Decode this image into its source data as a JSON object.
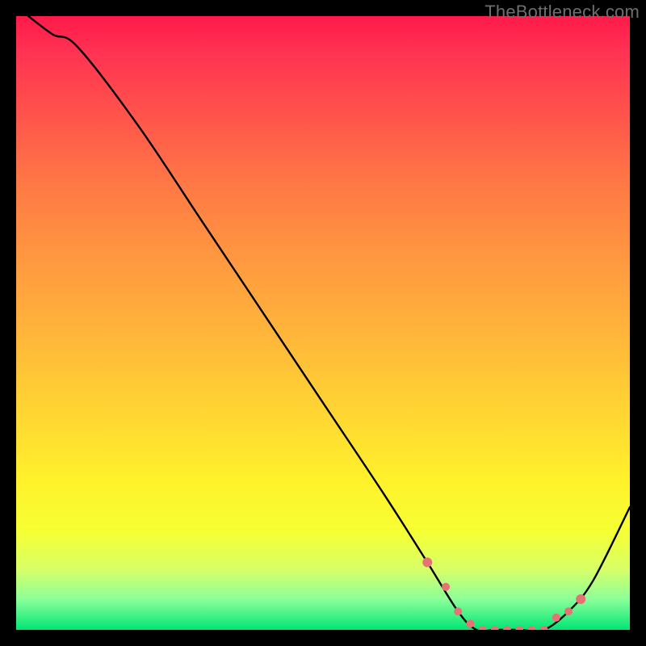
{
  "watermark": "TheBottleneck.com",
  "chart_data": {
    "type": "line",
    "title": "",
    "xlabel": "",
    "ylabel": "",
    "xlim": [
      0,
      100
    ],
    "ylim": [
      0,
      100
    ],
    "series": [
      {
        "name": "bottleneck-curve",
        "x": [
          2,
          6,
          10,
          20,
          30,
          40,
          50,
          60,
          67,
          72,
          75,
          78,
          82,
          86,
          90,
          94,
          100
        ],
        "y": [
          100,
          97,
          95,
          82,
          67,
          52,
          37,
          22,
          11,
          3,
          0,
          0,
          0,
          0,
          3,
          8,
          20
        ]
      }
    ],
    "markers": {
      "name": "highlight-dots",
      "color": "#e57373",
      "x": [
        67,
        70,
        72,
        74,
        76,
        78,
        80,
        82,
        84,
        86,
        88,
        90,
        92
      ],
      "y": [
        11,
        7,
        3,
        1,
        0,
        0,
        0,
        0,
        0,
        0,
        2,
        3,
        5
      ]
    },
    "gradient_stops": [
      {
        "pos": 0.0,
        "color": "#ff1a4a"
      },
      {
        "pos": 0.06,
        "color": "#ff3352"
      },
      {
        "pos": 0.18,
        "color": "#ff5a4a"
      },
      {
        "pos": 0.28,
        "color": "#ff7a45"
      },
      {
        "pos": 0.4,
        "color": "#ff9940"
      },
      {
        "pos": 0.52,
        "color": "#ffb63a"
      },
      {
        "pos": 0.64,
        "color": "#ffd433"
      },
      {
        "pos": 0.76,
        "color": "#fff22b"
      },
      {
        "pos": 0.84,
        "color": "#f6ff33"
      },
      {
        "pos": 0.9,
        "color": "#d9ff66"
      },
      {
        "pos": 0.95,
        "color": "#8cff99"
      },
      {
        "pos": 1.0,
        "color": "#00e676"
      }
    ]
  }
}
